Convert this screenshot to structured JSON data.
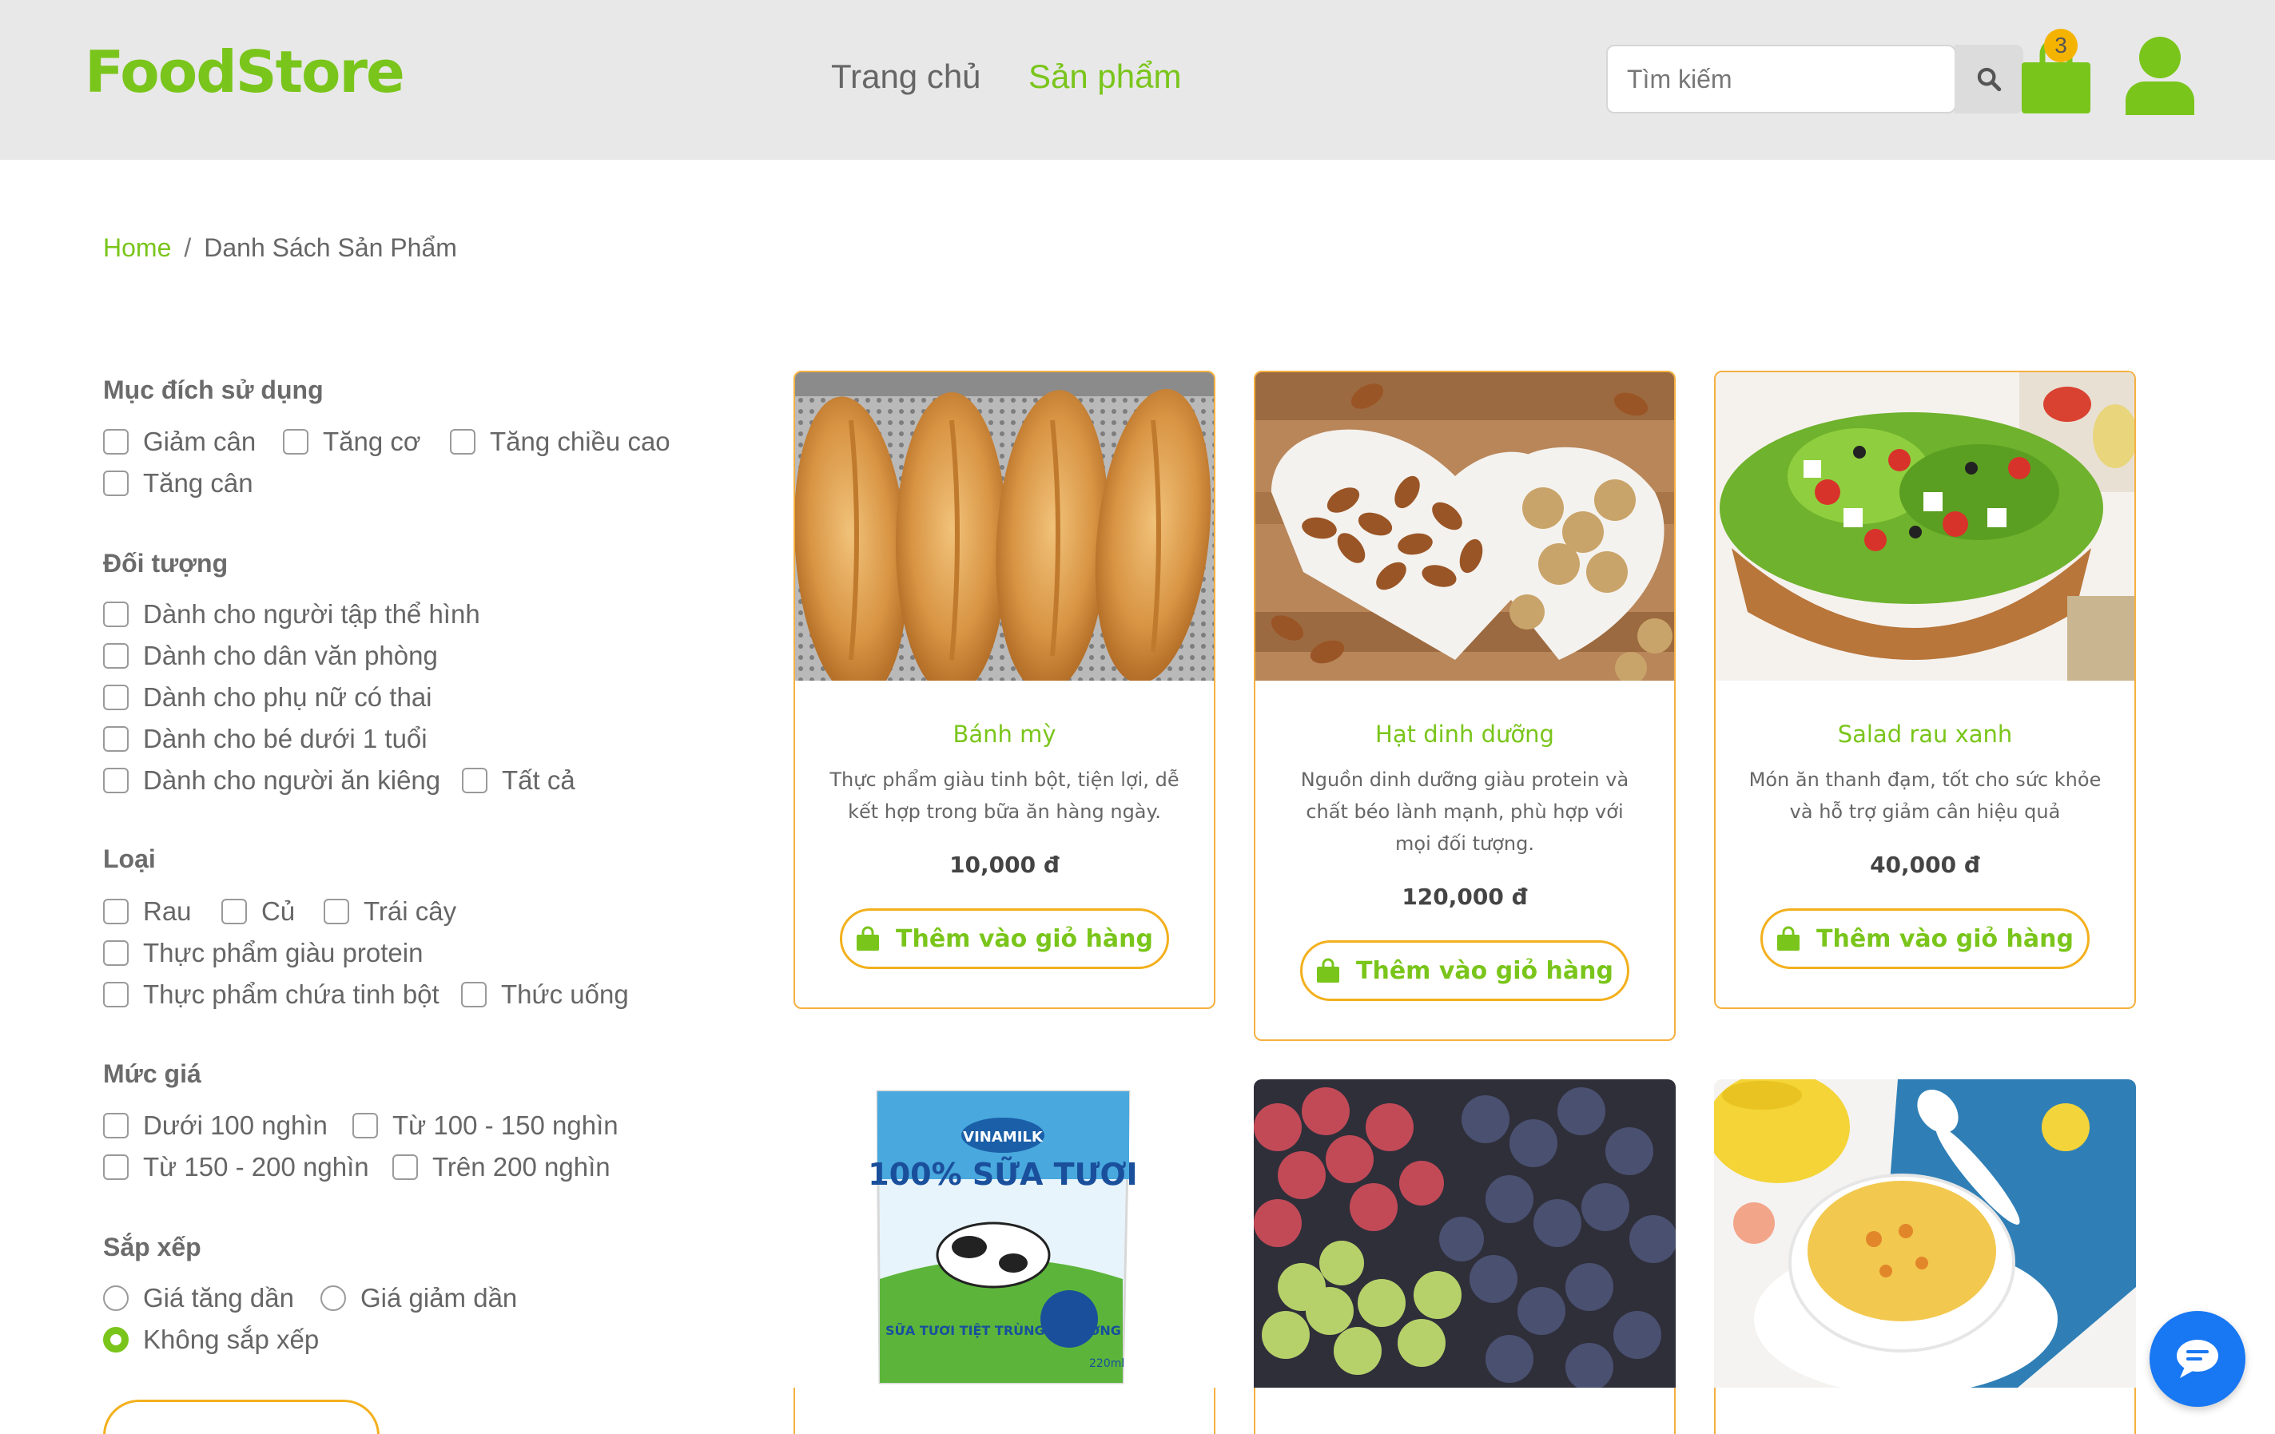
{
  "header": {
    "logo": "FoodStore",
    "nav": {
      "home": "Trang chủ",
      "products": "Sản phẩm"
    },
    "search_placeholder": "Tìm kiếm",
    "cart_count": "3"
  },
  "breadcrumb": {
    "home": "Home",
    "separator": "/",
    "current": "Danh Sách Sản Phẩm"
  },
  "filters": {
    "purpose": {
      "title": "Mục đích sử dụng",
      "options": [
        "Giảm cân",
        "Tăng cơ",
        "Tăng chiều cao",
        "Tăng cân"
      ]
    },
    "audience": {
      "title": "Đối tượng",
      "options": [
        "Dành cho người tập thể hình",
        "Dành cho dân văn phòng",
        "Dành cho phụ nữ có thai",
        "Dành cho bé dưới 1 tuổi",
        "Dành cho người ăn kiêng",
        "Tất cả"
      ]
    },
    "type": {
      "title": "Loại",
      "options": [
        "Rau",
        "Củ",
        "Trái cây",
        "Thực phẩm giàu protein",
        "Thực phẩm chứa tinh bột",
        "Thức uống"
      ]
    },
    "price": {
      "title": "Mức giá",
      "options": [
        "Dưới 100 nghìn",
        "Từ 100 - 150 nghìn",
        "Từ 150 - 200 nghìn",
        "Trên 200 nghìn"
      ]
    },
    "sort": {
      "title": "Sắp xếp",
      "options": [
        "Giá tăng dần",
        "Giá giảm dần",
        "Không sắp xếp"
      ],
      "selected": "Không sắp xếp"
    }
  },
  "products": [
    {
      "name": "Bánh mỳ",
      "desc": "Thực phẩm giàu tinh bột, tiện lợi, dễ kết hợp trong bữa ăn hàng ngày.",
      "price": "10,000 đ",
      "button": "Thêm vào giỏ hàng"
    },
    {
      "name": "Hạt dinh dưỡng",
      "desc": "Nguồn dinh dưỡng giàu protein và chất béo lành mạnh, phù hợp với mọi đối tượng.",
      "price": "120,000 đ",
      "button": "Thêm vào giỏ hàng"
    },
    {
      "name": "Salad rau xanh",
      "desc": "Món ăn thanh đạm, tốt cho sức khỏe và hỗ trợ giảm cân hiệu quả",
      "price": "40,000 đ",
      "button": "Thêm vào giỏ hàng"
    }
  ],
  "milk_pack": {
    "brand": "VINAMILK",
    "headline": "100% SỮA TƯƠI",
    "sub": "SỮA TƯƠI TIỆT TRÙNG ÍT ĐƯỜNG",
    "volume": "220ml"
  },
  "colors": {
    "brand_green": "#7ac51b",
    "accent_orange": "#f3b01d",
    "chat_blue": "#1877f2",
    "header_bg": "#e8e8e8"
  }
}
